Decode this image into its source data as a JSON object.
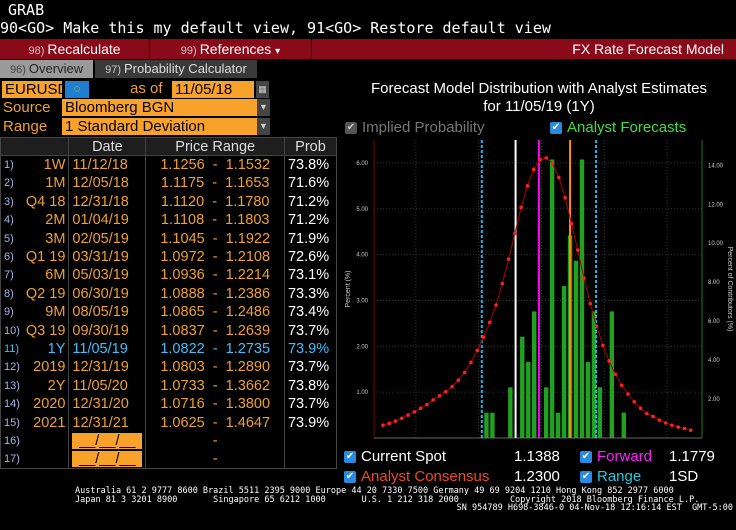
{
  "header": {
    "grab": "GRAB",
    "command": "90<GO> Make this my default view, 91<GO> Restore default view"
  },
  "toolbar": {
    "recalc_num": "98)",
    "recalc": "Recalculate",
    "refs_num": "99)",
    "refs": "References",
    "refs_arrow": "▾",
    "title": "FX Rate Forecast Model"
  },
  "tabs": [
    {
      "num": "96)",
      "label": "Overview",
      "active": true
    },
    {
      "num": "97)",
      "label": "Probability Calculator",
      "active": false
    }
  ],
  "controls": {
    "pair": "EURUSD",
    "as_of_label": "as of",
    "as_of": "11/05/18",
    "source_label": "Source",
    "source": "Bloomberg BGN",
    "range_label": "Range",
    "range": "1 Standard Deviation"
  },
  "table": {
    "headers": [
      "",
      "Date",
      "Price Range",
      "Prob"
    ],
    "rows": [
      {
        "n": "1)",
        "term": "1W",
        "date": "11/12/18",
        "low": "1.1256",
        "high": "1.1532",
        "prob": "73.8%"
      },
      {
        "n": "2)",
        "term": "1M",
        "date": "12/05/18",
        "low": "1.1175",
        "high": "1.1653",
        "prob": "71.6%"
      },
      {
        "n": "3)",
        "term": "Q4 18",
        "date": "12/31/18",
        "low": "1.1120",
        "high": "1.1780",
        "prob": "71.2%"
      },
      {
        "n": "4)",
        "term": "2M",
        "date": "01/04/19",
        "low": "1.1108",
        "high": "1.1803",
        "prob": "71.2%"
      },
      {
        "n": "5)",
        "term": "3M",
        "date": "02/05/19",
        "low": "1.1045",
        "high": "1.1922",
        "prob": "71.9%"
      },
      {
        "n": "6)",
        "term": "Q1 19",
        "date": "03/31/19",
        "low": "1.0972",
        "high": "1.2108",
        "prob": "72.6%"
      },
      {
        "n": "7)",
        "term": "6M",
        "date": "05/03/19",
        "low": "1.0936",
        "high": "1.2214",
        "prob": "73.1%"
      },
      {
        "n": "8)",
        "term": "Q2 19",
        "date": "06/30/19",
        "low": "1.0888",
        "high": "1.2386",
        "prob": "73.3%"
      },
      {
        "n": "9)",
        "term": "9M",
        "date": "08/05/19",
        "low": "1.0865",
        "high": "1.2486",
        "prob": "73.4%"
      },
      {
        "n": "10)",
        "term": "Q3 19",
        "date": "09/30/19",
        "low": "1.0837",
        "high": "1.2639",
        "prob": "73.7%"
      },
      {
        "n": "11)",
        "term": "1Y",
        "date": "11/05/19",
        "low": "1.0822",
        "high": "1.2735",
        "prob": "73.9%",
        "highlight": true
      },
      {
        "n": "12)",
        "term": "2019",
        "date": "12/31/19",
        "low": "1.0803",
        "high": "1.2890",
        "prob": "73.7%"
      },
      {
        "n": "13)",
        "term": "2Y",
        "date": "11/05/20",
        "low": "1.0733",
        "high": "1.3662",
        "prob": "73.8%"
      },
      {
        "n": "14)",
        "term": "2020",
        "date": "12/31/20",
        "low": "1.0716",
        "high": "1.3800",
        "prob": "73.7%"
      },
      {
        "n": "15)",
        "term": "2021",
        "date": "12/31/21",
        "low": "1.0625",
        "high": "1.4647",
        "prob": "73.9%"
      },
      {
        "n": "16)",
        "term": "",
        "date": "__/__/__",
        "low": "",
        "high": "",
        "prob": "",
        "blank": true
      },
      {
        "n": "17)",
        "term": "",
        "date": "__/__/__",
        "low": "",
        "high": "",
        "prob": "",
        "blank": true
      }
    ]
  },
  "chart_title": {
    "line1": "Forecast Model Distribution with Analyst Estimates",
    "line2": "for  11/05/19 (1Y)"
  },
  "chart_toggles": {
    "implied": "Implied Probability",
    "analyst": "Analyst Forecasts"
  },
  "chart_data": {
    "type": "bar+line",
    "ylabel": "Percent (%)",
    "y2label": "Percent of Contributors (%)",
    "xlim": [
      0.9017,
      1.451
    ],
    "ylim": [
      0,
      6.5
    ],
    "y2lim": [
      0,
      15.3
    ],
    "xticks": [
      "0.9718",
      "1.0770",
      "1.1822",
      "1.2874",
      "1.3926"
    ],
    "yticks": [
      "1.00",
      "2.00",
      "3.00",
      "4.00",
      "5.00",
      "6.00"
    ],
    "y2ticks": [
      "2.00",
      "4.00",
      "6.00",
      "8.00",
      "10.00",
      "12.00",
      "14.00"
    ],
    "grid": true,
    "implied_probability": {
      "x_start": 0.9167,
      "x_step": 0.01052,
      "y": [
        0.28,
        0.32,
        0.37,
        0.43,
        0.5,
        0.57,
        0.65,
        0.73,
        0.83,
        0.92,
        1.01,
        1.12,
        1.26,
        1.43,
        1.65,
        1.91,
        2.2,
        2.52,
        2.9,
        3.37,
        3.9,
        4.46,
        5.03,
        5.5,
        5.86,
        6.07,
        6.11,
        5.99,
        5.68,
        5.24,
        4.68,
        4.1,
        3.49,
        2.93,
        2.44,
        2.02,
        1.68,
        1.39,
        1.15,
        0.96,
        0.79,
        0.65,
        0.53,
        0.47,
        0.39,
        0.33,
        0.28,
        0.24,
        0.21,
        0.17
      ]
    },
    "analyst_forecasts": {
      "x": [
        1.09,
        1.1,
        1.13,
        1.15,
        1.16,
        1.17,
        1.19,
        1.2,
        1.21,
        1.22,
        1.23,
        1.24,
        1.25,
        1.26,
        1.27,
        1.28,
        1.3,
        1.32
      ],
      "y": [
        1.3,
        1.3,
        2.6,
        5.2,
        3.9,
        6.5,
        2.6,
        14.3,
        1.3,
        7.8,
        10.4,
        9.1,
        14.3,
        3.9,
        6.5,
        2.6,
        6.5,
        1.3
      ]
    },
    "lines": {
      "spot": 1.1388,
      "forward": 1.1779,
      "consensus": 1.23,
      "range_low": 1.0822,
      "range_high": 1.2735
    },
    "colors": {
      "curve": "#ff2020",
      "bars": "#22a022",
      "spot": "#ffffff",
      "forward": "#ff00ff",
      "consensus": "#ff8c00",
      "range": "#19b6f0"
    }
  },
  "legend": {
    "spot_label": "Current Spot",
    "spot": "1.1388",
    "forward_label": "Forward",
    "forward": "1.1779",
    "consensus_label": "Analyst Consensus",
    "consensus": "1.2300",
    "range_label": "Range",
    "range": "1SD"
  },
  "footer": {
    "l1": "Australia 61 2 9777 8600 Brazil 5511 2395 9000 Europe 44 20 7330 7500 Germany 49 69 9204 1210 Hong Kong 852 2977 6000",
    "l2": "Japan 81 3 3201 8900       Singapore 65 6212 1000       U.S. 1 212 318 2000          Copyright 2018 Bloomberg Finance L.P.",
    "l3": "SN 954789 H698-3846-0 04-Nov-18 12:16:14 EST  GMT-5:00"
  }
}
